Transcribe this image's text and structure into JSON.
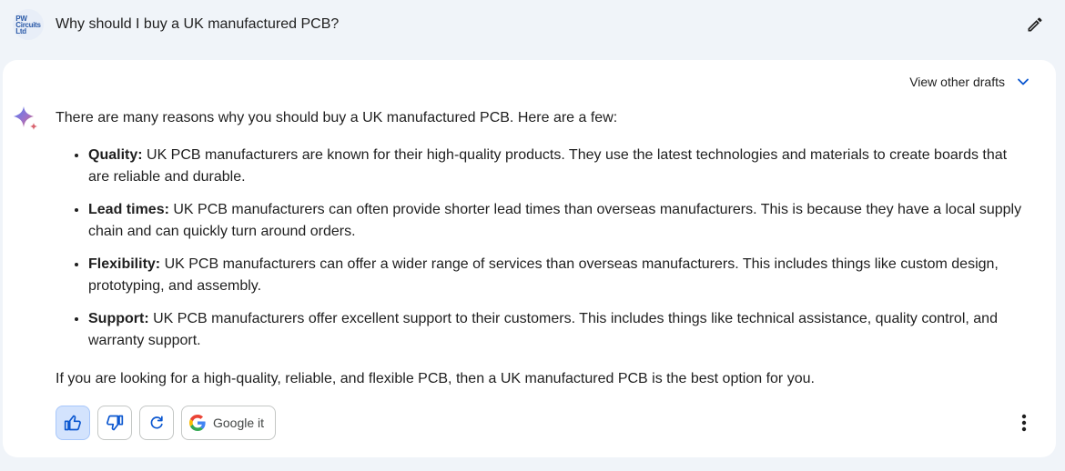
{
  "header": {
    "avatar_logo": [
      "PW",
      "Circuits",
      "Ltd"
    ],
    "prompt": "Why should I buy a UK manufactured PCB?"
  },
  "response": {
    "drafts_label": "View other drafts",
    "intro": "There are many reasons why you should buy a UK manufactured PCB. Here are a few:",
    "items": [
      {
        "term": "Quality:",
        "text": " UK PCB manufacturers are known for their high-quality products. They use the latest technologies and materials to create boards that are reliable and durable."
      },
      {
        "term": "Lead times:",
        "text": " UK PCB manufacturers can often provide shorter lead times than overseas manufacturers. This is because they have a local supply chain and can quickly turn around orders."
      },
      {
        "term": "Flexibility:",
        "text": " UK PCB manufacturers can offer a wider range of services than overseas manufacturers. This includes things like custom design, prototyping, and assembly."
      },
      {
        "term": "Support:",
        "text": " UK PCB manufacturers offer excellent support to their customers. This includes things like technical assistance, quality control, and warranty support."
      }
    ],
    "outro": "If you are looking for a high-quality, reliable, and flexible PCB, then a UK manufactured PCB is the best option for you."
  },
  "actions": {
    "google_label": "Google it"
  },
  "colors": {
    "accent": "#0b57d0",
    "active_bg": "#d3e3fd"
  }
}
